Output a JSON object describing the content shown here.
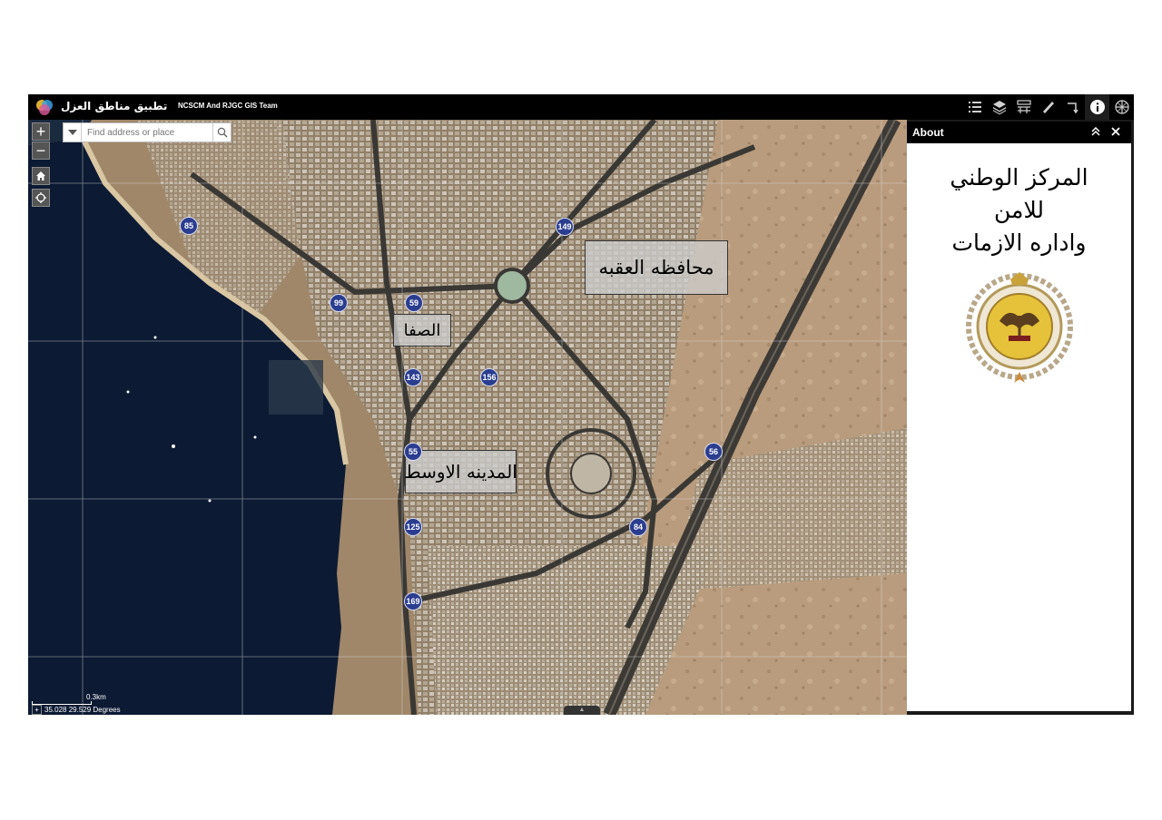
{
  "header": {
    "app_title": "تطبيق مناطق العزل",
    "team": "NCSCM And RJGC GIS Team"
  },
  "toolbar": {
    "items": [
      "legend-icon",
      "layers-icon",
      "basemap-gallery-icon",
      "measurement-icon",
      "directions-icon",
      "info-icon",
      "attribute-table-icon"
    ]
  },
  "search": {
    "placeholder": "Find address or place"
  },
  "map": {
    "labels": {
      "aqaba_governorate": "محافظه العقبه",
      "safa": "الصفا",
      "middle_city": "المدينه الاوسط"
    },
    "route_shields": [
      "85",
      "149",
      "99",
      "59",
      "143",
      "156",
      "56",
      "55",
      "125",
      "84",
      "169"
    ],
    "scale": "0.3km",
    "coordinates": "35.028 29.529 Degrees"
  },
  "about": {
    "title": "About",
    "line1": "المركز الوطني",
    "line2": "للامن",
    "line3": "واداره الازمات"
  },
  "colors": {
    "header_bg": "#000000",
    "shield": "#2b3d8f",
    "sea": "#0c1a33",
    "land": "#a48a6a"
  }
}
